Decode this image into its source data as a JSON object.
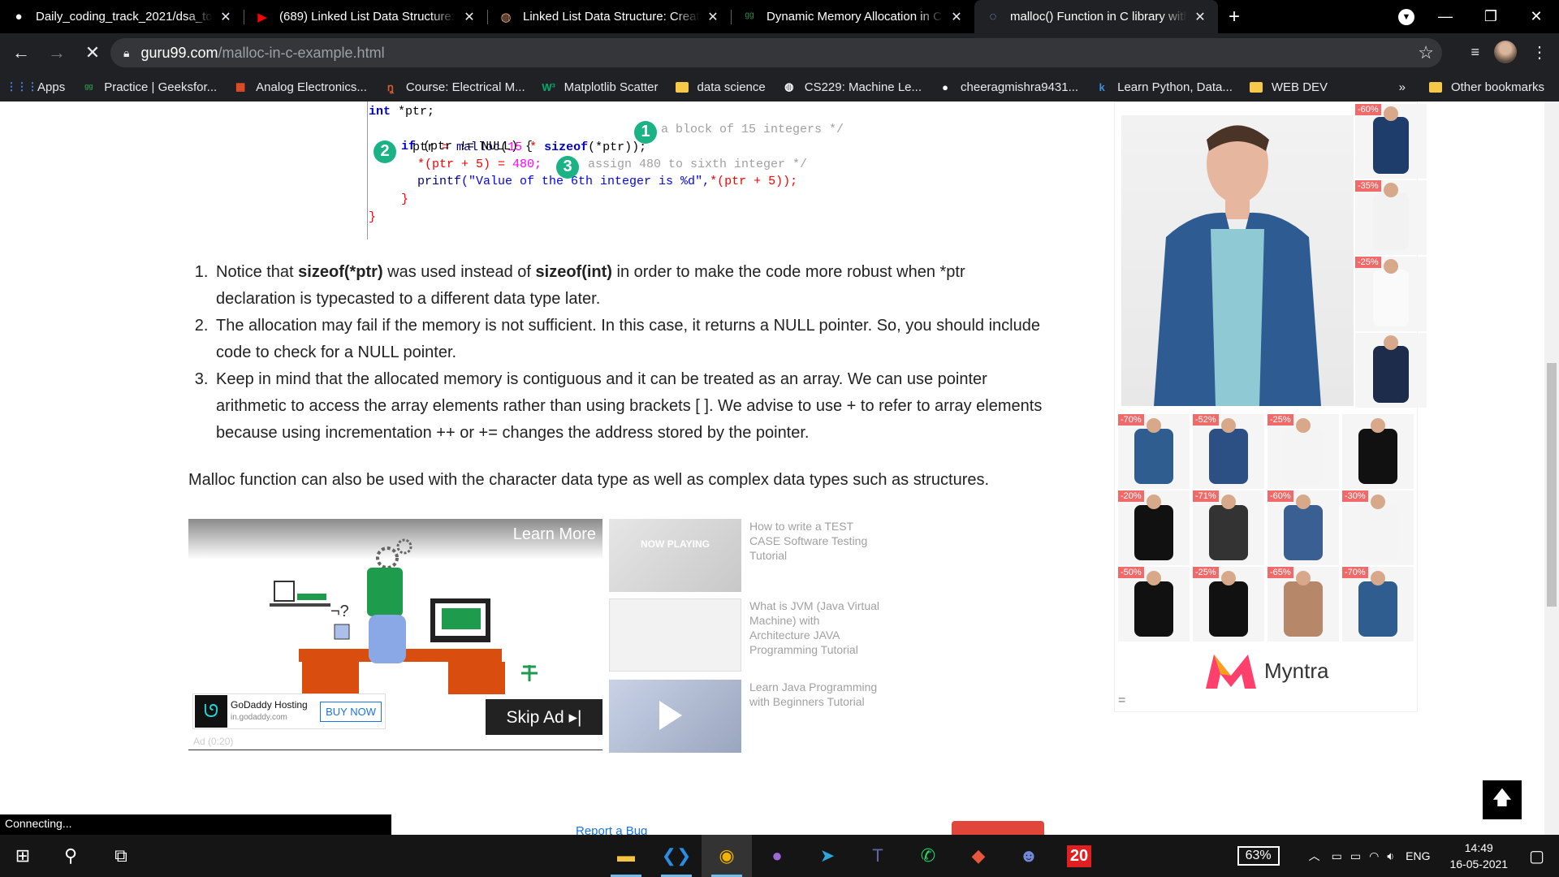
{
  "tabs": [
    {
      "title": "Daily_coding_track_2021/dsa_top",
      "icon": "github-icon"
    },
    {
      "title": "(689) Linked List Data Structure: C",
      "icon": "youtube-icon"
    },
    {
      "title": "Linked List Data Structure: Creati",
      "icon": "site-icon"
    },
    {
      "title": "Dynamic Memory Allocation in C",
      "icon": "geeksforgeeks-icon"
    },
    {
      "title": "malloc() Function in C library with",
      "icon": "loading-icon",
      "active": true
    }
  ],
  "address": {
    "host": "guru99.com",
    "path": "/malloc-in-c-example.html"
  },
  "bookmarks": [
    {
      "label": "Apps",
      "icon": "apps-grid-icon"
    },
    {
      "label": "Practice | Geeksfor...",
      "icon": "geeksforgeeks-icon"
    },
    {
      "label": "Analog Electronics...",
      "icon": "microsoft-icon"
    },
    {
      "label": "Course: Electrical M...",
      "icon": "nptel-icon"
    },
    {
      "label": "Matplotlib Scatter",
      "icon": "w3-icon"
    },
    {
      "label": "data science",
      "icon": "folder-icon"
    },
    {
      "label": "CS229: Machine Le...",
      "icon": "globe-icon"
    },
    {
      "label": "cheeragmishra9431...",
      "icon": "github-icon"
    },
    {
      "label": "Learn Python, Data...",
      "icon": "k-icon"
    },
    {
      "label": "WEB DEV",
      "icon": "folder-icon"
    }
  ],
  "bookmarks_more": "»",
  "other_bookmarks": "Other bookmarks",
  "code": {
    "l1_kw": "int",
    "l1_rest": " *ptr;",
    "l2": [
      "ptr",
      " = ",
      "malloc",
      "(",
      "15",
      " * ",
      "sizeof",
      "(*ptr));"
    ],
    "l2_comment": "a block of 15 integers */",
    "l3_kw": "if",
    "l3_rest": " (ptr != NULL) {",
    "l4_a": "*(ptr + 5) = ",
    "l4_num": "480;",
    "l4_comment": "assign 480 to sixth integer */",
    "l5_fn": "printf",
    "l5_str": "(\"Value of the 6th integer is %d\",",
    "l5_rest": "*(ptr + 5));",
    "l6": "}",
    "l7": "}",
    "badges": [
      "1",
      "2",
      "3"
    ]
  },
  "list": [
    {
      "pre": "Notice that ",
      "b1": "sizeof(*ptr)",
      "mid": " was used instead of ",
      "b2": "sizeof(int)",
      "post": " in order to make the code more robust when *ptr declaration is typecasted to a different data type later."
    },
    {
      "text": "The allocation may fail if the memory is not sufficient. In this case, it returns a NULL pointer. So, you should include code to check for a NULL pointer."
    },
    {
      "text": "Keep in mind that the allocated memory is contiguous and it can be treated as an array. We can use pointer arithmetic to access the array elements rather than using brackets [ ]. We advise to use + to refer to array elements because using incrementation ++ or += changes the address stored by the pointer."
    }
  ],
  "paragraph": "Malloc function can also be used with the character data type as well as complex data types such as structures.",
  "ad": {
    "learn_more": "Learn More",
    "skip": "Skip Ad ▸|",
    "brand": "GoDaddy Hosting",
    "domain": "in.godaddy.com",
    "buy_now": "BUY NOW",
    "timer": "Ad (0:20)"
  },
  "videos": [
    {
      "title": "How to write a TEST CASE Software Testing Tutorial",
      "overlay": "NOW PLAYING"
    },
    {
      "title": "What is JVM (Java Virtual Machine) with Architecture JAVA Programming Tutorial"
    },
    {
      "title": "Learn Java Programming with Beginners Tutorial"
    }
  ],
  "sidebar": {
    "discounts_right": [
      "-60%",
      "-35%",
      "-25%",
      ""
    ],
    "grid": [
      "-70%",
      "-52%",
      "-25%",
      "",
      "-20%",
      "-71%",
      "-60%",
      "-30%",
      "-50%",
      "-25%",
      "-65%",
      "-70%"
    ],
    "brand": "Myntra",
    "menu": "="
  },
  "status_text": "Connecting...",
  "report_bug": "Report a Bug",
  "taskbar": {
    "battery": "63%",
    "lang": "ENG",
    "time": "14:49",
    "date": "16-05-2021",
    "badge": "20"
  }
}
